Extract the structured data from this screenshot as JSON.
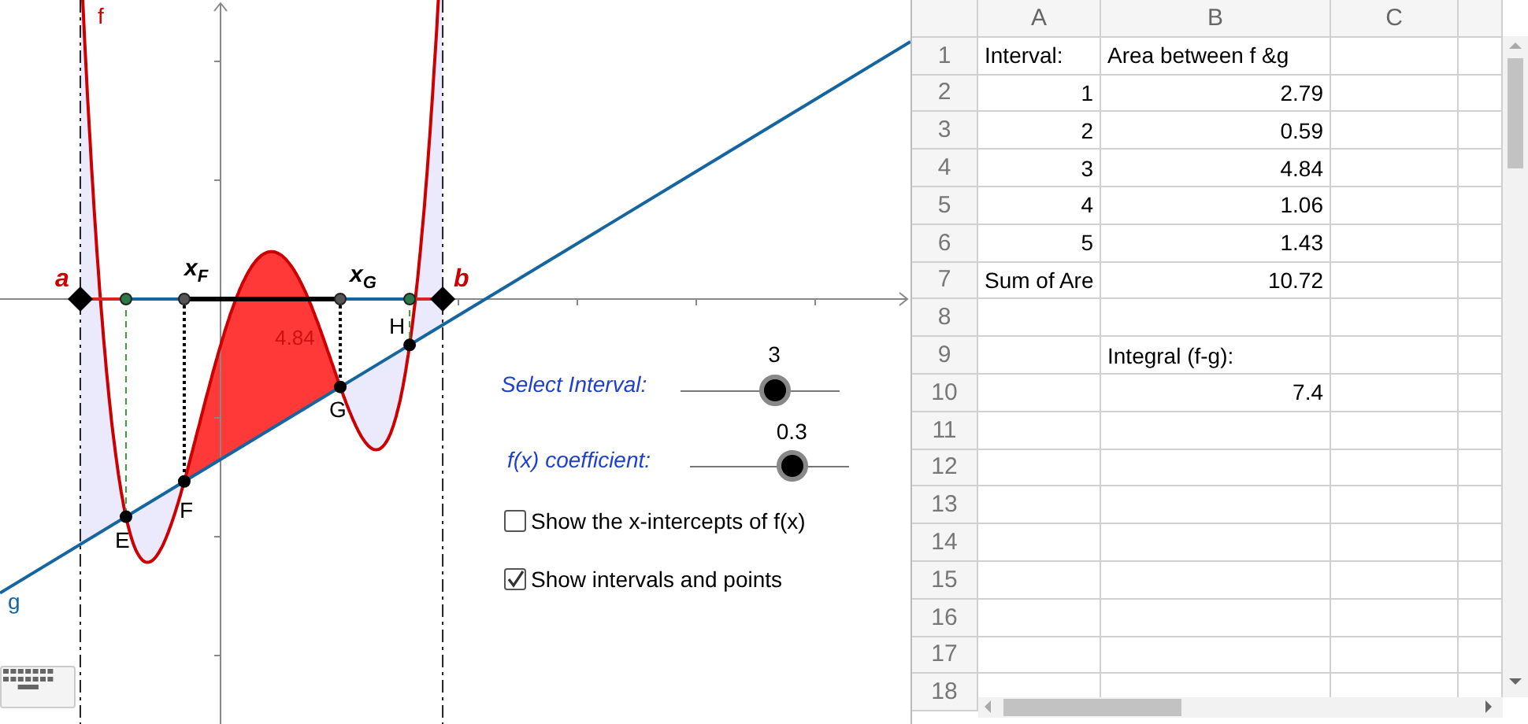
{
  "graphics": {
    "function_label": "f",
    "line_label": "g",
    "bounds": [
      "a",
      "b"
    ],
    "points": [
      "E",
      "F",
      "G",
      "H"
    ],
    "interval_markers": [
      "x$_{F}$",
      "x$_{G}$"
    ],
    "intervals": [
      {
        "selected": false
      },
      {
        "selected": false
      },
      {
        "selected": true,
        "area_label": "4.84"
      },
      {
        "selected": false
      },
      {
        "selected": false
      }
    ],
    "sliders": [
      {
        "label": "Select Interval:",
        "value": "3",
        "level": 0.59
      },
      {
        "label": "f(x) coefficient:",
        "value": "0.3",
        "level": 0.64
      }
    ],
    "checkboxes": [
      {
        "label": "Show the x-intercepts of f(x)",
        "checked": false
      },
      {
        "label": "Show intervals and points",
        "checked": true
      }
    ]
  },
  "spreadsheet": {
    "columns": [
      "A",
      "B",
      "C"
    ],
    "rows": [
      {
        "number": "1",
        "cells": [
          {
            "text": "Interval:",
            "kind": "text"
          },
          {
            "text": "Area between f &g",
            "kind": "text"
          }
        ]
      },
      {
        "number": "2",
        "cells": [
          {
            "text": "1",
            "kind": "number"
          },
          {
            "text": "2.79",
            "kind": "number"
          }
        ]
      },
      {
        "number": "3",
        "cells": [
          {
            "text": "2",
            "kind": "number"
          },
          {
            "text": "0.59",
            "kind": "number"
          }
        ]
      },
      {
        "number": "4",
        "cells": [
          {
            "text": "3",
            "kind": "number"
          },
          {
            "text": "4.84",
            "kind": "number"
          }
        ]
      },
      {
        "number": "5",
        "cells": [
          {
            "text": "4",
            "kind": "number"
          },
          {
            "text": "1.06",
            "kind": "number"
          }
        ]
      },
      {
        "number": "6",
        "cells": [
          {
            "text": "5",
            "kind": "number"
          },
          {
            "text": "1.43",
            "kind": "number"
          }
        ]
      },
      {
        "number": "7",
        "cells": [
          {
            "text": "Sum of Are",
            "kind": "text"
          },
          {
            "text": "10.72",
            "kind": "number"
          }
        ]
      },
      {
        "number": "8",
        "cells": []
      },
      {
        "number": "9",
        "cells": [
          {
            "kind": "empty"
          },
          {
            "text": "Integral (f-g):",
            "kind": "text"
          }
        ]
      },
      {
        "number": "10",
        "cells": [
          {
            "kind": "empty"
          },
          {
            "text": "7.4",
            "kind": "number"
          }
        ]
      },
      {
        "number": "11",
        "cells": []
      },
      {
        "number": "12",
        "cells": []
      },
      {
        "number": "13",
        "cells": []
      },
      {
        "number": "14",
        "cells": []
      },
      {
        "number": "15",
        "cells": []
      },
      {
        "number": "16",
        "cells": []
      },
      {
        "number": "17",
        "cells": []
      },
      {
        "number": "18",
        "cells": []
      }
    ]
  }
}
